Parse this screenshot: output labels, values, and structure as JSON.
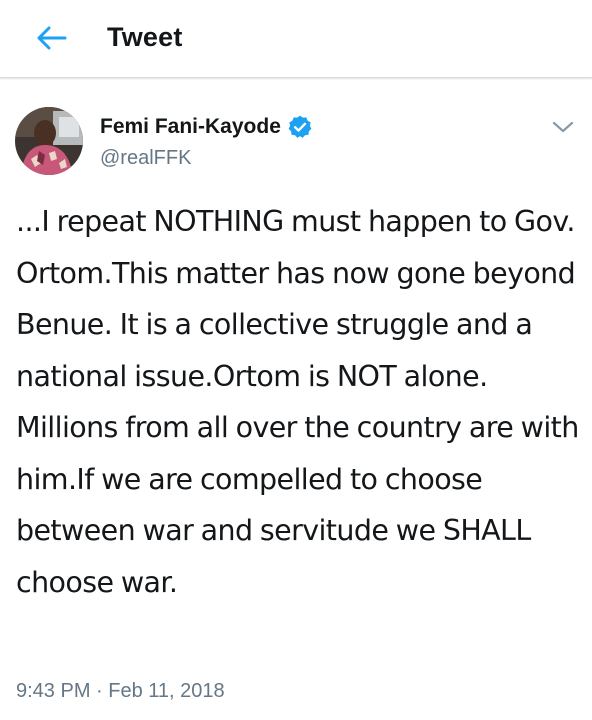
{
  "header": {
    "title": "Tweet",
    "back_icon": "arrow-left-icon",
    "accent": "#1da1f2"
  },
  "tweet": {
    "author": {
      "name": "Femi Fani-Kayode",
      "handle": "@realFFK",
      "verified": true,
      "verified_icon": "verified-badge-icon"
    },
    "text": "...I repeat NOTHING must happen to Gov. Ortom.This matter has now gone beyond Benue. It is a collective struggle and a national issue.Ortom is NOT alone. Millions from all over the country are with him.If we are compelled to choose between war and servitude we SHALL choose war.",
    "timestamp": "9:43 PM · Feb 11, 2018",
    "more_icon": "chevron-down-icon"
  },
  "colors": {
    "text_primary": "#14171a",
    "text_secondary": "#657786",
    "verified_blue": "#1da1f2",
    "divider": "#d6dbdf"
  }
}
